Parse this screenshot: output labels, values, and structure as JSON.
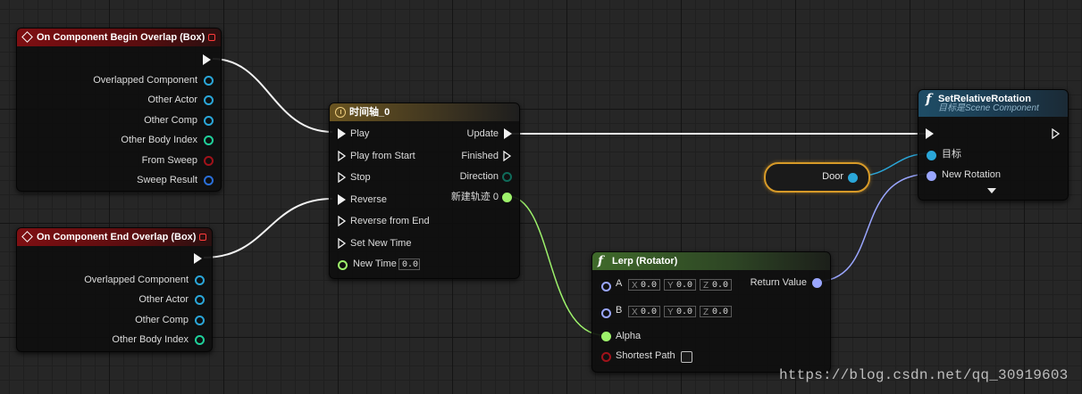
{
  "nodes": {
    "begin_overlap": {
      "title": "On Component Begin Overlap (Box)",
      "pins": [
        "Overlapped Component",
        "Other Actor",
        "Other Comp",
        "Other Body Index",
        "From Sweep",
        "Sweep Result"
      ]
    },
    "end_overlap": {
      "title": "On Component End Overlap (Box)",
      "pins": [
        "Overlapped Component",
        "Other Actor",
        "Other Comp",
        "Other Body Index"
      ]
    },
    "timeline": {
      "title": "时间轴_0",
      "inputs": [
        "Play",
        "Play from Start",
        "Stop",
        "Reverse",
        "Reverse from End",
        "Set New Time",
        "New Time"
      ],
      "new_time_value": "0.0",
      "outputs": [
        "Update",
        "Finished",
        "Direction",
        "新建轨迹 0"
      ]
    },
    "lerp": {
      "title": "Lerp (Rotator)",
      "a_label": "A",
      "b_label": "B",
      "a": {
        "x": "0.0",
        "y": "0.0",
        "z": "0.0"
      },
      "b": {
        "x": "0.0",
        "y": "0.0",
        "z": "0.0"
      },
      "axis": {
        "x": "X",
        "y": "Y",
        "z": "Z"
      },
      "alpha": "Alpha",
      "shortest_path": "Shortest Path",
      "return_value": "Return Value"
    },
    "set_rotation": {
      "title": "SetRelativeRotation",
      "subtitle": "目标是Scene Component",
      "target": "目标",
      "new_rotation": "New Rotation"
    },
    "door_var": {
      "label": "Door"
    }
  },
  "watermark": "https://blog.csdn.net/qq_30919603",
  "colors": {
    "event_header": "#7e0f12",
    "timeline_header": "#6a5420",
    "function_header": "#3f6a2a",
    "call_header": "#1f4d66",
    "object_pin": "#2aa6d8",
    "int_pin": "#1fcf9a",
    "bool_pin": "#a0121a",
    "struct_pin": "#2a6fd8",
    "float_pin": "#9df26b",
    "rotator_pin": "#9aa6ff",
    "variable_outline": "#d79a28"
  }
}
